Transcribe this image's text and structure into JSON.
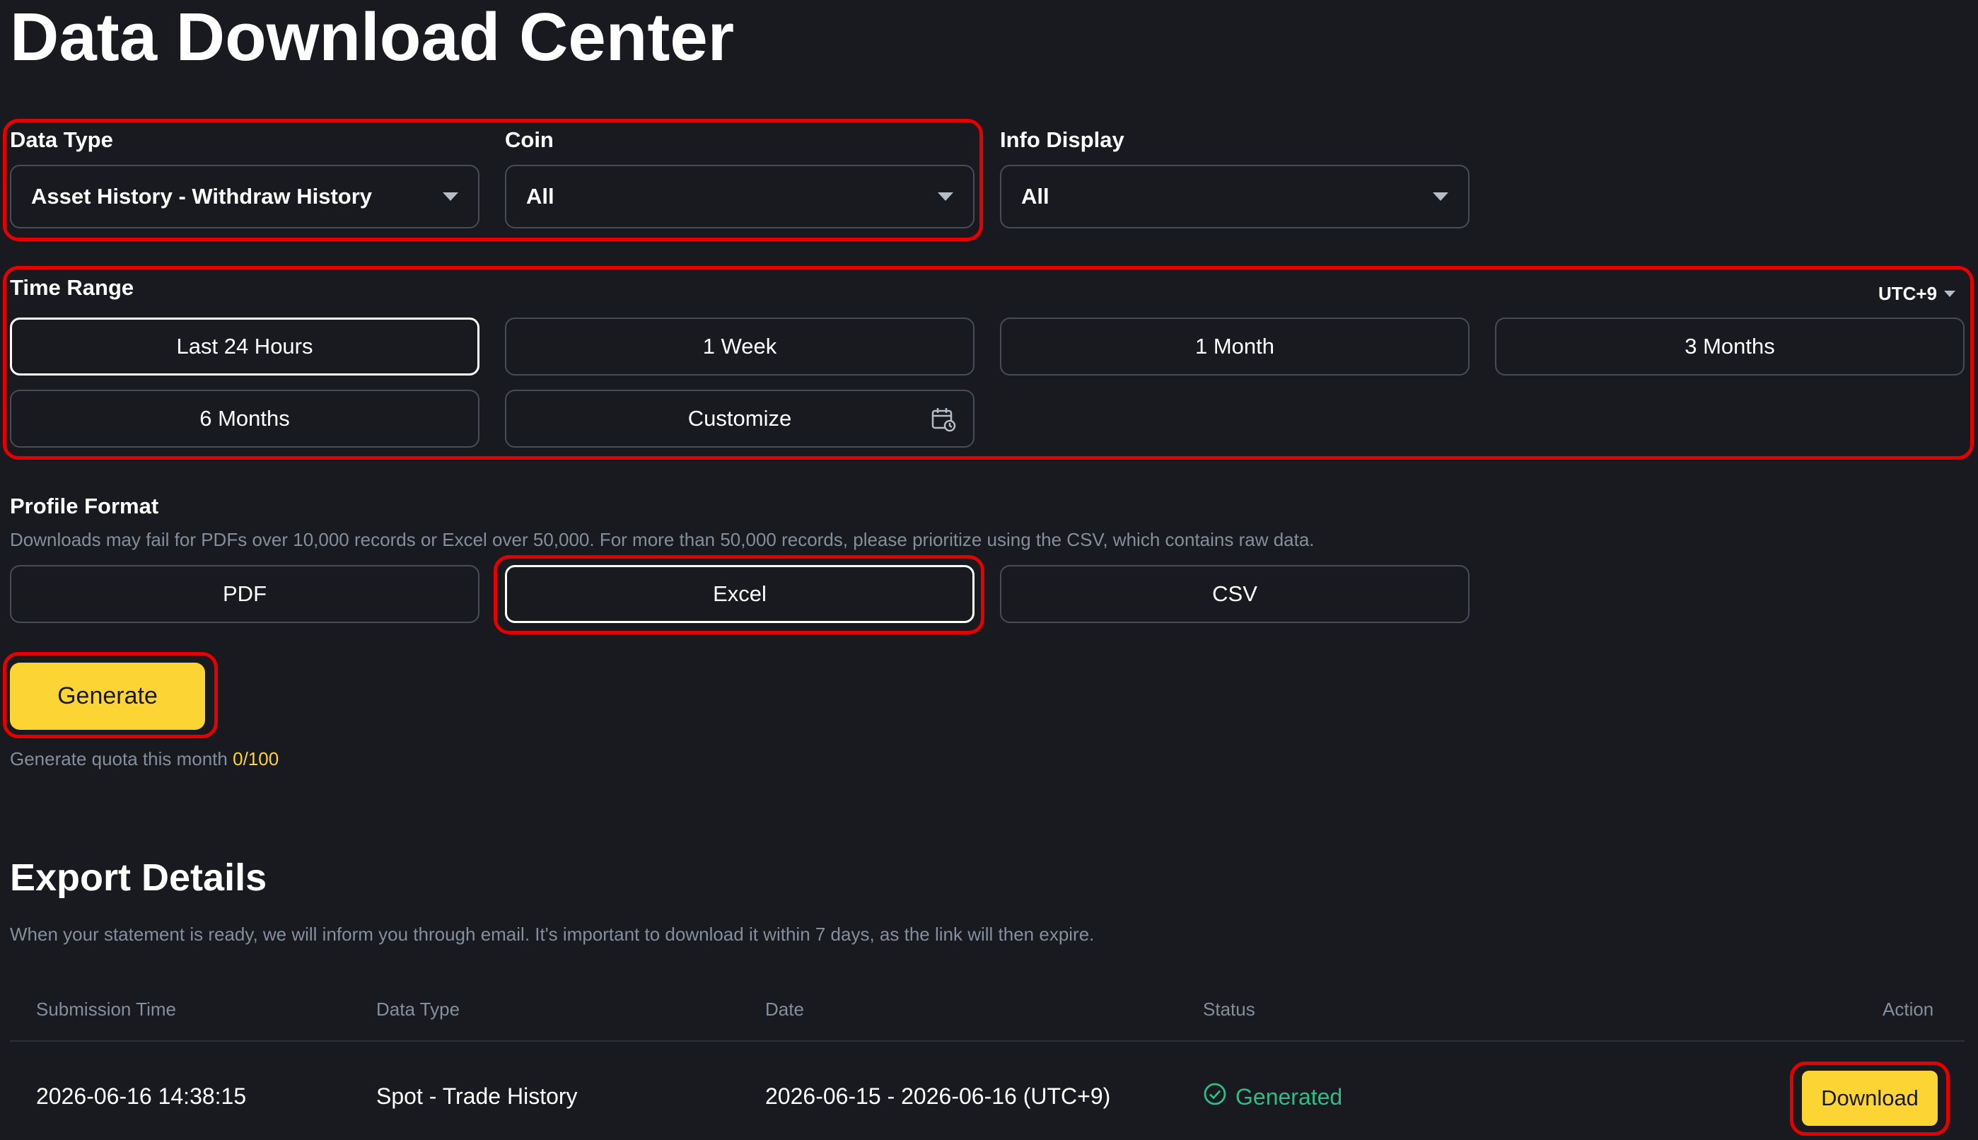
{
  "page": {
    "title": "Data Download Center"
  },
  "filters": {
    "data_type": {
      "label": "Data Type",
      "value": "Asset History - Withdraw History"
    },
    "coin": {
      "label": "Coin",
      "value": "All"
    },
    "info_display": {
      "label": "Info Display",
      "value": "All"
    }
  },
  "time_range": {
    "label": "Time Range",
    "timezone": "UTC+9",
    "options": [
      "Last 24 Hours",
      "1 Week",
      "1 Month",
      "3 Months",
      "6 Months",
      "Customize"
    ],
    "selected": "Last 24 Hours"
  },
  "profile_format": {
    "label": "Profile Format",
    "note": "Downloads may fail for PDFs over 10,000 records or Excel over 50,000. For more than 50,000 records, please prioritize using the CSV, which contains raw data.",
    "options": [
      "PDF",
      "Excel",
      "CSV"
    ],
    "selected": "Excel"
  },
  "generate": {
    "button_label": "Generate",
    "quota_label": "Generate quota this month",
    "quota_value": "0/100"
  },
  "export_details": {
    "title": "Export Details",
    "note": "When your statement is ready, we will inform you through email. It's important to download it within 7 days, as the link will then expire.",
    "columns": [
      "Submission Time",
      "Data Type",
      "Date",
      "Status",
      "Action"
    ],
    "rows": [
      {
        "submission_time": "2026-06-16 14:38:15",
        "data_type": "Spot - Trade History",
        "date": "2026-06-15 - 2026-06-16 (UTC+9)",
        "status": "Generated",
        "action": "Download"
      }
    ]
  },
  "colors": {
    "background": "#181a20",
    "accent": "#fcd535",
    "success": "#2ebd85",
    "highlight": "#e60000"
  },
  "icons": [
    "caret-down-icon",
    "calendar-icon",
    "check-circle-icon"
  ]
}
